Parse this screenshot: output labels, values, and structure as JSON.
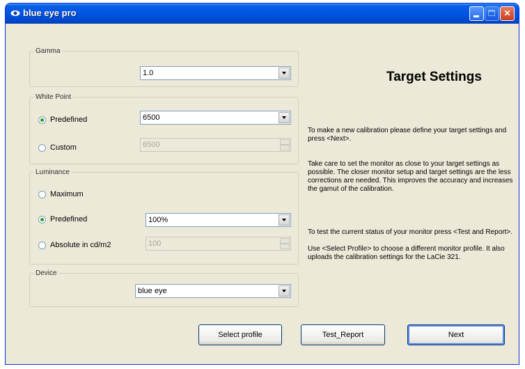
{
  "window": {
    "title": "blue eye pro"
  },
  "gamma": {
    "legend": "Gamma",
    "value": "1.0"
  },
  "white_point": {
    "legend": "White Point",
    "predefined_label": "Predefined",
    "predefined_value": "6500",
    "custom_label": "Custom",
    "custom_value": "6500"
  },
  "luminance": {
    "legend": "Luminance",
    "maximum_label": "Maximum",
    "predefined_label": "Predefined",
    "predefined_value": "100%",
    "absolute_label": "Absolute in cd/m2",
    "absolute_value": "100"
  },
  "device": {
    "legend": "Device",
    "value": "blue eye"
  },
  "info": {
    "heading": "Target Settings",
    "p1": "To make a new calibration please define your target settings and press <Next>.",
    "p2": "Take care to set the monitor as close to your target settings as possible. The closer monitor setup and target settings are the less corrections are needed. This improves the accuracy and increases the gamut of the calibration.",
    "p3": "To test the current status of your monitor press <Test and Report>.",
    "p4": "Use <Select Profile> to choose a different monitor profile. It also uploads the calibration settings for the LaCie 321."
  },
  "buttons": {
    "select_profile": "Select profile",
    "test_report": "Test_Report",
    "next": "Next"
  }
}
